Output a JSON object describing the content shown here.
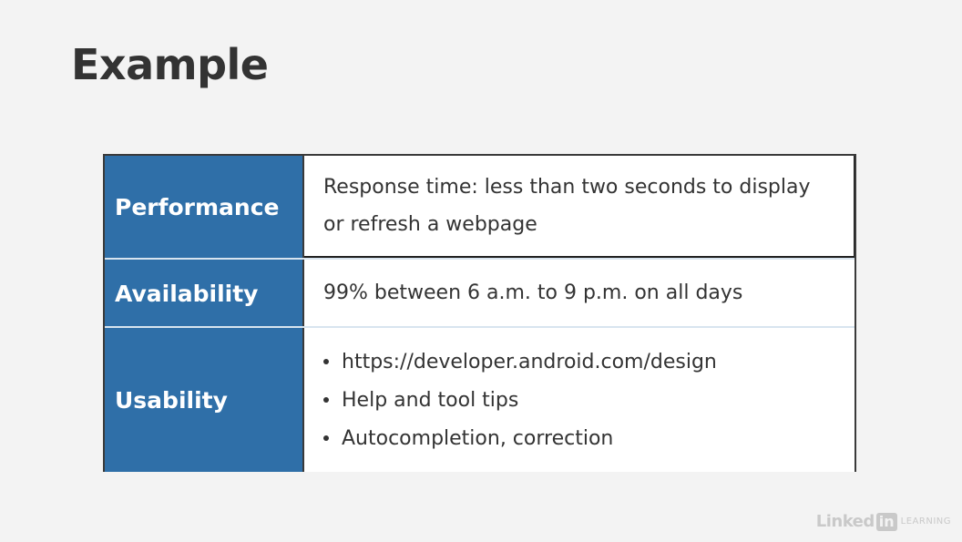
{
  "slide": {
    "title": "Example"
  },
  "table": {
    "rows": [
      {
        "label": "Performance",
        "value": "Response time: less than two seconds to display or refresh a webpage"
      },
      {
        "label": "Availability",
        "value": "99% between 6 a.m. to 9 p.m. on all days"
      },
      {
        "label": "Usability",
        "bullets": [
          "https://developer.android.com/design",
          "Help and tool tips",
          "Autocompletion, correction"
        ]
      }
    ]
  },
  "colors": {
    "label_background": "#2f6fa8",
    "label_text": "#ffffff",
    "slide_background": "#f3f3f3",
    "body_text": "#333333"
  },
  "icons": {
    "bullet": "bullet-dot-icon"
  },
  "watermark": {
    "brand": "LinkedIn",
    "word_linked": "Linked",
    "word_in": "in",
    "word_learning": "LEARNING"
  }
}
